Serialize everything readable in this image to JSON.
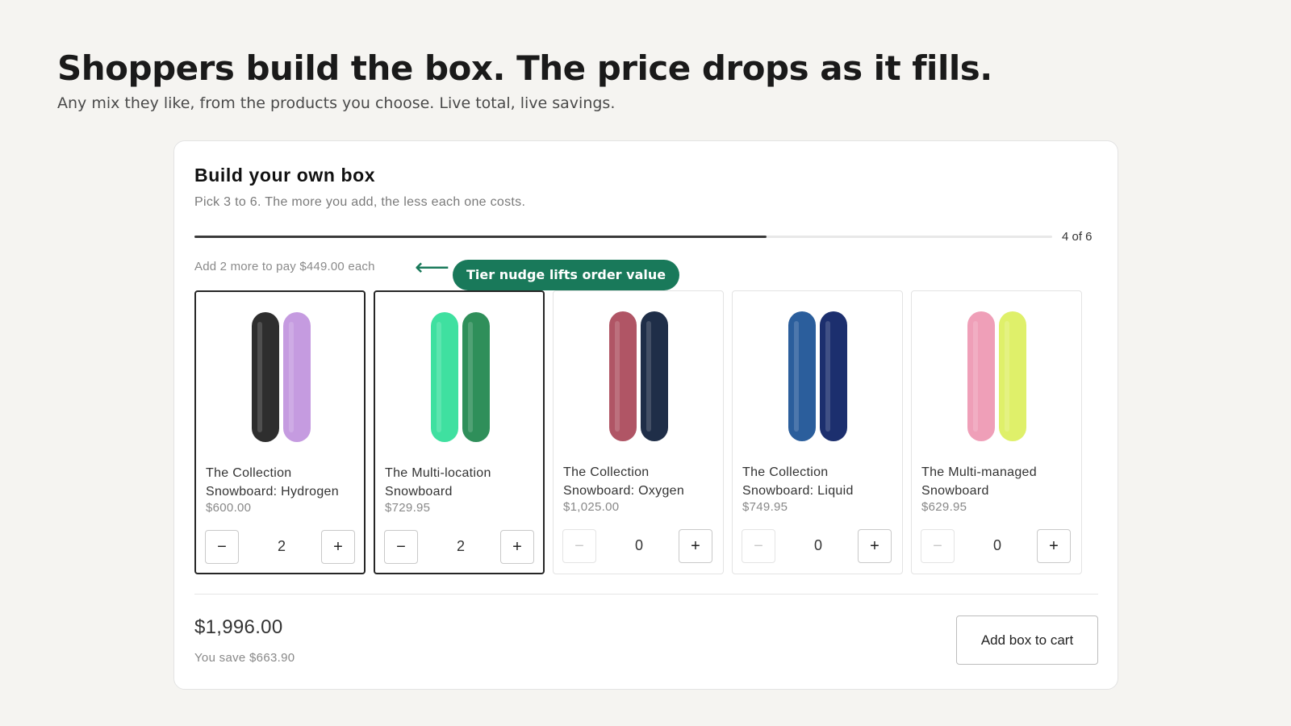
{
  "hero": {
    "headline": "Shoppers build the box. The price drops as it fills.",
    "subheadline": "Any mix they like, from the products you choose. Live total, live savings."
  },
  "builder": {
    "title": "Build your own box",
    "subtitle": "Pick 3 to 6. The more you add, the less each one costs.",
    "progress": {
      "selected": 4,
      "max": 6,
      "label": "4 of 6"
    },
    "nudge_text": "Add 2 more to pay $449.00 each",
    "callout": {
      "text": "Tier nudge lifts order value",
      "arrow_glyph": "⟵",
      "color": "#19795a"
    },
    "products": [
      {
        "name": "The Collection Snowboard: Hydrogen",
        "price": "$600.00",
        "quantity": "2",
        "selected": true,
        "colors": [
          "#2e2e2e",
          "#c59be0"
        ]
      },
      {
        "name": "The Multi-location Snowboard",
        "price": "$729.95",
        "quantity": "2",
        "selected": true,
        "colors": [
          "#3fe0a0",
          "#2f8f5a"
        ]
      },
      {
        "name": "The Collection Snowboard: Oxygen",
        "price": "$1,025.00",
        "quantity": "0",
        "selected": false,
        "colors": [
          "#b05565",
          "#1f2e48"
        ]
      },
      {
        "name": "The Collection Snowboard: Liquid",
        "price": "$749.95",
        "quantity": "0",
        "selected": false,
        "colors": [
          "#2b5e9c",
          "#1c2f6e"
        ]
      },
      {
        "name": "The Multi-managed Snowboard",
        "price": "$629.95",
        "quantity": "0",
        "selected": false,
        "colors": [
          "#ef9fb8",
          "#dff06a"
        ]
      }
    ],
    "qty_controls": {
      "minus_glyph": "−",
      "plus_glyph": "+"
    },
    "summary": {
      "total": "$1,996.00",
      "savings": "You save $663.90",
      "cart_button": "Add box to cart"
    }
  }
}
